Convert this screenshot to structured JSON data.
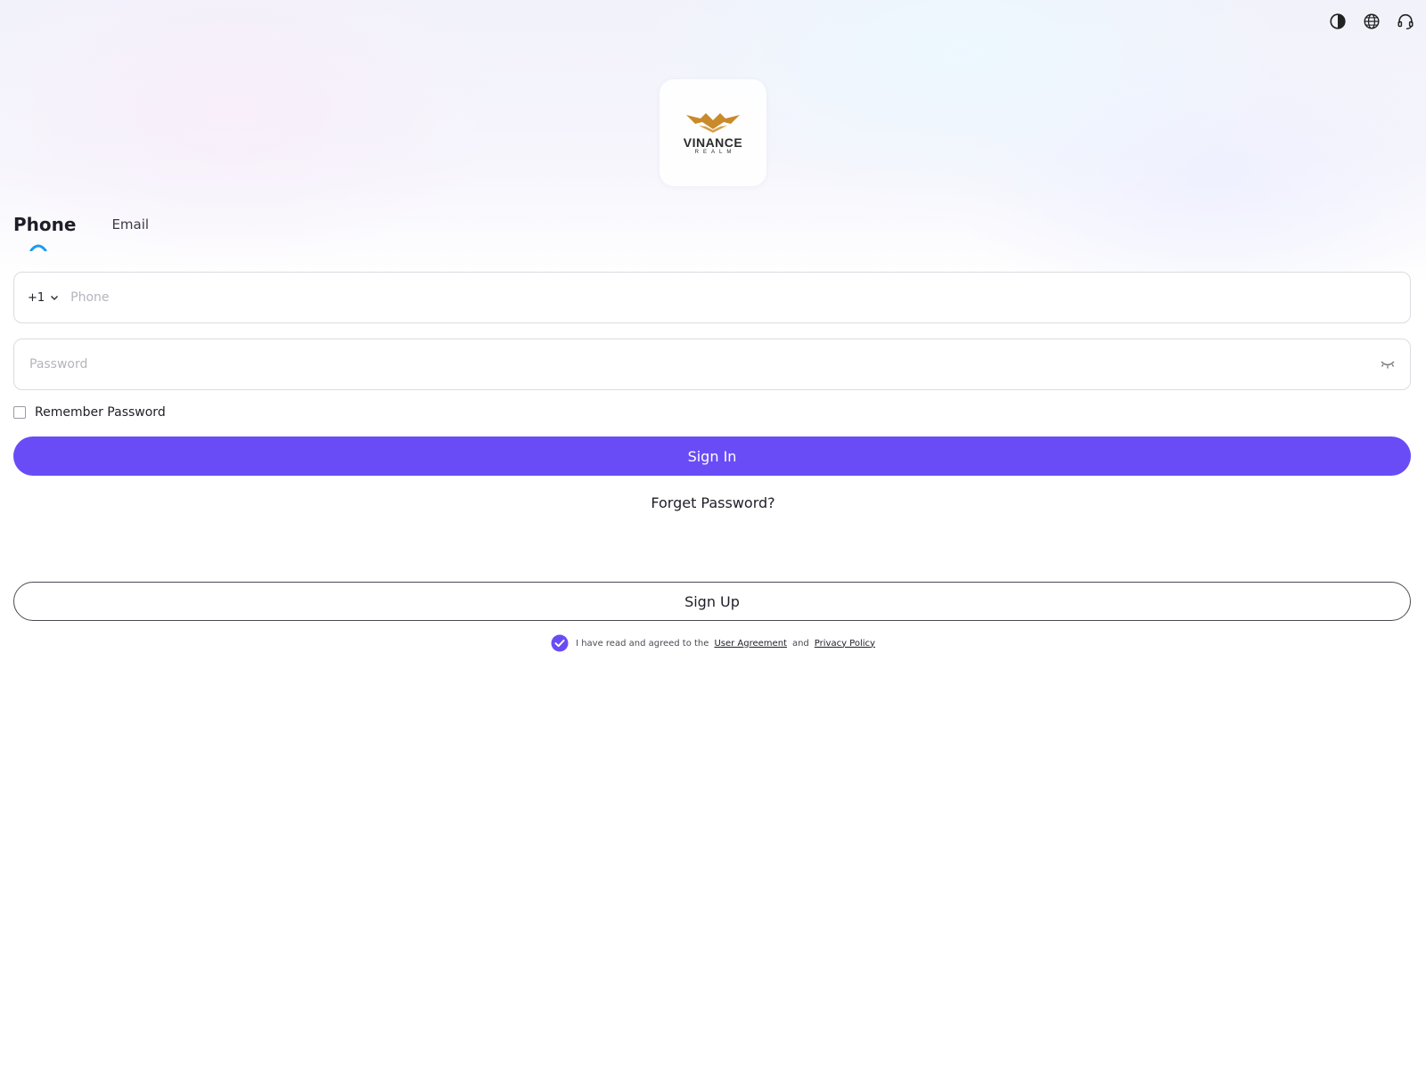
{
  "header": {
    "icons": [
      "theme-contrast-icon",
      "globe-language-icon",
      "headset-support-icon"
    ]
  },
  "logo": {
    "name": "VINANCE",
    "sub": "REALM"
  },
  "tabs": [
    {
      "label": "Phone",
      "active": true
    },
    {
      "label": "Email",
      "active": false
    }
  ],
  "form": {
    "country_code": "+1",
    "phone_placeholder": "Phone",
    "phone_value": "",
    "password_placeholder": "Password",
    "password_value": "",
    "remember_label": "Remember Password",
    "remember_checked": false,
    "signin_label": "Sign In",
    "forget_label": "Forget Password?",
    "signup_label": "Sign Up"
  },
  "agreement": {
    "checked": true,
    "prefix": "I have read and agreed to the",
    "user_agreement": "User Agreement",
    "and": "and",
    "privacy_policy": "Privacy Policy"
  },
  "colors": {
    "accent": "#6a4cf6",
    "tab_indicator": "#1a9cf0",
    "logo_gold": "#c98a2a"
  }
}
